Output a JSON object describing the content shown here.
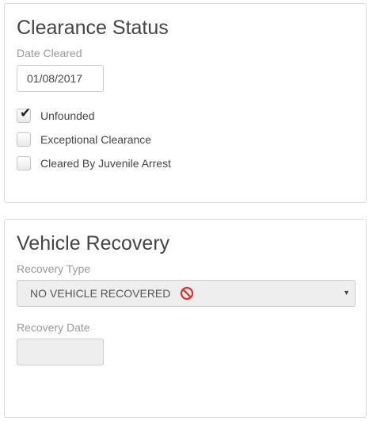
{
  "clearance": {
    "title": "Clearance Status",
    "date_label": "Date Cleared",
    "date_value": "01/08/2017",
    "options": [
      {
        "label": "Unfounded",
        "checked": true
      },
      {
        "label": "Exceptional Clearance",
        "checked": false
      },
      {
        "label": "Cleared By Juvenile Arrest",
        "checked": false
      }
    ]
  },
  "vehicle": {
    "title": "Vehicle Recovery",
    "type_label": "Recovery Type",
    "type_value": "NO VEHICLE RECOVERED",
    "type_icon": "no-entry-icon",
    "date_label": "Recovery Date",
    "date_value": ""
  },
  "icons": {
    "check": "✔",
    "caret": "▼"
  },
  "colors": {
    "no_icon_red": "#d9342b"
  }
}
